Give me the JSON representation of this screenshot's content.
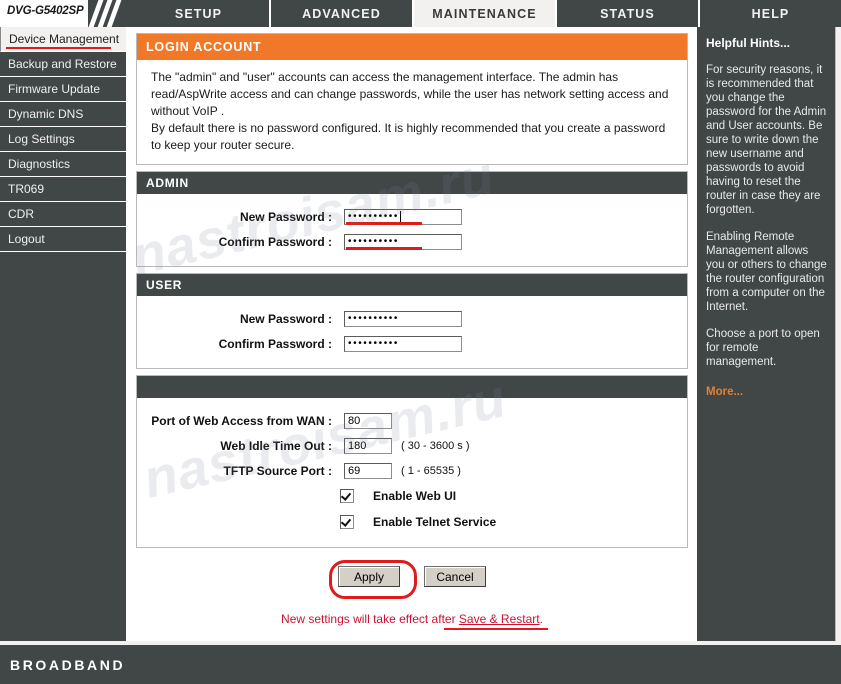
{
  "device": {
    "model": "DVG-G5402SP"
  },
  "tabs": [
    {
      "label": "SETUP",
      "active": false
    },
    {
      "label": "ADVANCED",
      "active": false
    },
    {
      "label": "MAINTENANCE",
      "active": true
    },
    {
      "label": "STATUS",
      "active": false
    },
    {
      "label": "HELP",
      "active": false
    }
  ],
  "sidebar": {
    "items": [
      {
        "label": "Device Management",
        "active": true
      },
      {
        "label": "Backup and Restore",
        "active": false
      },
      {
        "label": "Firmware Update",
        "active": false
      },
      {
        "label": "Dynamic DNS",
        "active": false
      },
      {
        "label": "Log Settings",
        "active": false
      },
      {
        "label": "Diagnostics",
        "active": false
      },
      {
        "label": "TR069",
        "active": false
      },
      {
        "label": "CDR",
        "active": false
      },
      {
        "label": "Logout",
        "active": false
      }
    ]
  },
  "login_account": {
    "title": "LOGIN ACCOUNT",
    "description_line1": "The \"admin\" and \"user\" accounts can access the management interface. The admin has read/AspWrite access and can change passwords, while the user has network setting access and without VoIP .",
    "description_line2": "By default there is no password configured. It is highly recommended that you create a password to keep your router secure."
  },
  "admin": {
    "title": "ADMIN",
    "new_password_label": "New Password :",
    "new_password_value": "••••••••••",
    "confirm_password_label": "Confirm Password :",
    "confirm_password_value": "••••••••••"
  },
  "user": {
    "title": "USER",
    "new_password_label": "New Password :",
    "new_password_value": "••••••••••",
    "confirm_password_label": "Confirm Password :",
    "confirm_password_value": "••••••••••"
  },
  "access_settings": {
    "title": "",
    "wan_port_label": "Port of Web Access from WAN :",
    "wan_port_value": "80",
    "idle_timeout_label": "Web Idle Time Out :",
    "idle_timeout_value": "180",
    "idle_timeout_range": "( 30 - 3600 s )",
    "tftp_port_label": "TFTP Source Port :",
    "tftp_port_value": "69",
    "tftp_port_range": "( 1 - 65535 )",
    "enable_web_ui_label": "Enable Web UI",
    "enable_web_ui_checked": true,
    "enable_telnet_label": "Enable Telnet Service",
    "enable_telnet_checked": true
  },
  "actions": {
    "apply_label": "Apply",
    "cancel_label": "Cancel",
    "notice_prefix": "New settings will take effect after ",
    "notice_link": "Save & Restart",
    "notice_suffix": "."
  },
  "hints": {
    "title": "Helpful Hints...",
    "paragraph1": "For security reasons, it is recommended that you change the password for the Admin and User accounts. Be sure to write down the new username and passwords to avoid having to reset the router in case they are forgotten.",
    "paragraph2": "Enabling Remote Management allows you or others to change the router configuration from a computer on the Internet.",
    "paragraph3": "Choose a port to open for remote management.",
    "more_label": "More..."
  },
  "footer": {
    "brand": "BROADBAND"
  },
  "watermark": {
    "text": "nastroisam.ru"
  },
  "colors": {
    "accent_orange": "#f07828",
    "dark_panel": "#414647",
    "annotation_red": "#e01b1b",
    "notice_red": "#cc1133",
    "hint_link": "#e08030"
  }
}
